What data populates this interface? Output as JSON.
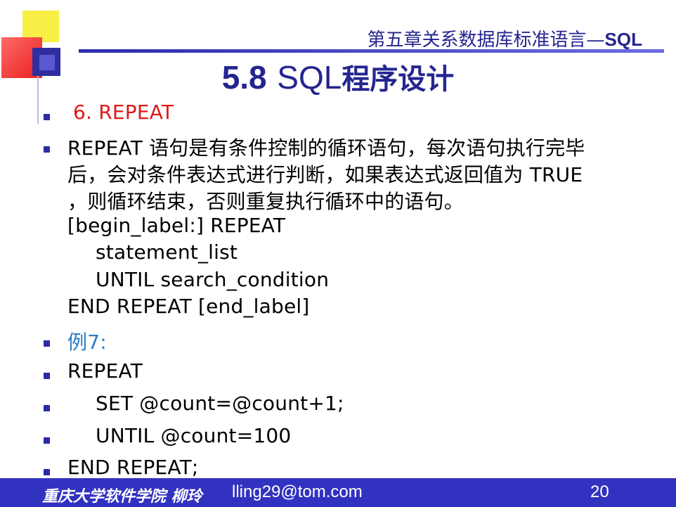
{
  "header": {
    "chapter_prefix": "第五章关系数据库标准语言—",
    "chapter_suffix": "SQL"
  },
  "title": {
    "number": "5.8",
    "sql": "SQL",
    "chinese": "程序设计"
  },
  "content": {
    "item_heading": "6. REPEAT",
    "desc_line1": "REPEAT 语句是有条件控制的循环语句，每次语句执行完毕",
    "desc_line2": "后，会对条件表达式进行判断，如果表达式返回值为 TRUE",
    "desc_line3": "，则循环结束，否则重复执行循环中的语句。",
    "syntax_line1": "[begin_label:] REPEAT",
    "syntax_line2": "statement_list",
    "syntax_line3": "UNTIL search_condition",
    "syntax_line4": "END REPEAT [end_label]",
    "example_label": "例7:",
    "code_line1": "REPEAT",
    "code_line2": "SET @count=@count+1;",
    "code_line3": "UNTIL @count=100",
    "code_line4": "END REPEAT;"
  },
  "footer": {
    "author": "重庆大学软件学院 柳玲",
    "email": "lling29@tom.com",
    "page_number": "20"
  },
  "colors": {
    "accent_blue": "#252590",
    "heading_red": "#e01818",
    "example_blue": "#2b7bc6",
    "footer_bg": "#3232c0"
  }
}
